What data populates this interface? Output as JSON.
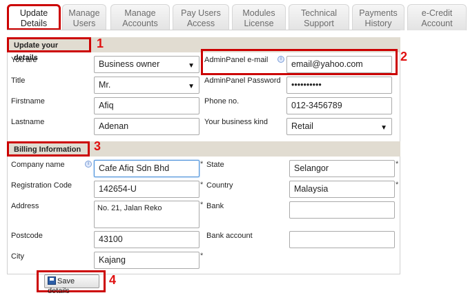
{
  "tabs": [
    {
      "line1": "Update",
      "line2": "Details"
    },
    {
      "line1": "Manage",
      "line2": "Users"
    },
    {
      "line1": "Manage",
      "line2": "Accounts"
    },
    {
      "line1": "Pay Users",
      "line2": "Access"
    },
    {
      "line1": "Modules",
      "line2": "License"
    },
    {
      "line1": "Technical",
      "line2": "Support"
    },
    {
      "line1": "Payments",
      "line2": "History"
    },
    {
      "line1": "e-Credit",
      "line2": "Account"
    }
  ],
  "sections": {
    "details": {
      "title": "Update your details",
      "callout": "1"
    },
    "email_callout": "2",
    "billing": {
      "title": "Billing Information",
      "callout": "3"
    },
    "save_callout": "4"
  },
  "details": {
    "you_are": {
      "label": "You are",
      "value": "Business owner"
    },
    "title": {
      "label": "Title",
      "value": "Mr."
    },
    "firstname": {
      "label": "Firstname",
      "value": "Afiq"
    },
    "lastname": {
      "label": "Lastname",
      "value": "Adenan"
    },
    "email": {
      "label": "AdminPanel e-mail",
      "value": "email@yahoo.com"
    },
    "password": {
      "label": "AdminPanel Password",
      "value": "••••••••••"
    },
    "phone": {
      "label": "Phone no.",
      "value": "012-3456789"
    },
    "business_kind": {
      "label": "Your business kind",
      "value": "Retail"
    }
  },
  "billing": {
    "company": {
      "label": "Company name",
      "value": "Cafe Afiq Sdn Bhd"
    },
    "reg_code": {
      "label": "Registration Code",
      "value": "142654-U"
    },
    "address": {
      "label": "Address",
      "value": "No. 21, Jalan Reko"
    },
    "postcode": {
      "label": "Postcode",
      "value": "43100"
    },
    "city": {
      "label": "City",
      "value": "Kajang"
    },
    "state": {
      "label": "State",
      "value": "Selangor"
    },
    "country": {
      "label": "Country",
      "value": "Malaysia"
    },
    "bank": {
      "label": "Bank",
      "value": ""
    },
    "bank_account": {
      "label": "Bank account",
      "value": ""
    }
  },
  "required_mark": "*",
  "info_glyph": "i",
  "dropdown_glyph": "▼",
  "save_label": "Save details"
}
